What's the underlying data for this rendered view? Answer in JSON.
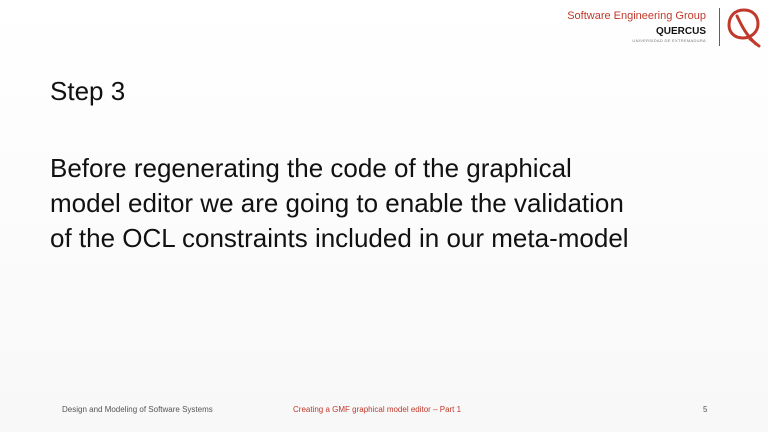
{
  "header": {
    "group_name": "Software Engineering Group",
    "brand": "QUERCUS",
    "brand_sub": "UNIVERSIDAD DE EXTREMADURA"
  },
  "logo": {
    "icon": "quercus-logo-icon",
    "color": "#c0392b"
  },
  "slide": {
    "title": "Step 3",
    "body_lines": [
      "Before regenerating the code of the graphical",
      "model editor we are going to enable the validation",
      "of the OCL constraints included in our meta-model"
    ]
  },
  "footer": {
    "course": "Design and Modeling of Software Systems",
    "topic": "Creating a GMF graphical model editor – Part 1",
    "page_number": "5"
  }
}
